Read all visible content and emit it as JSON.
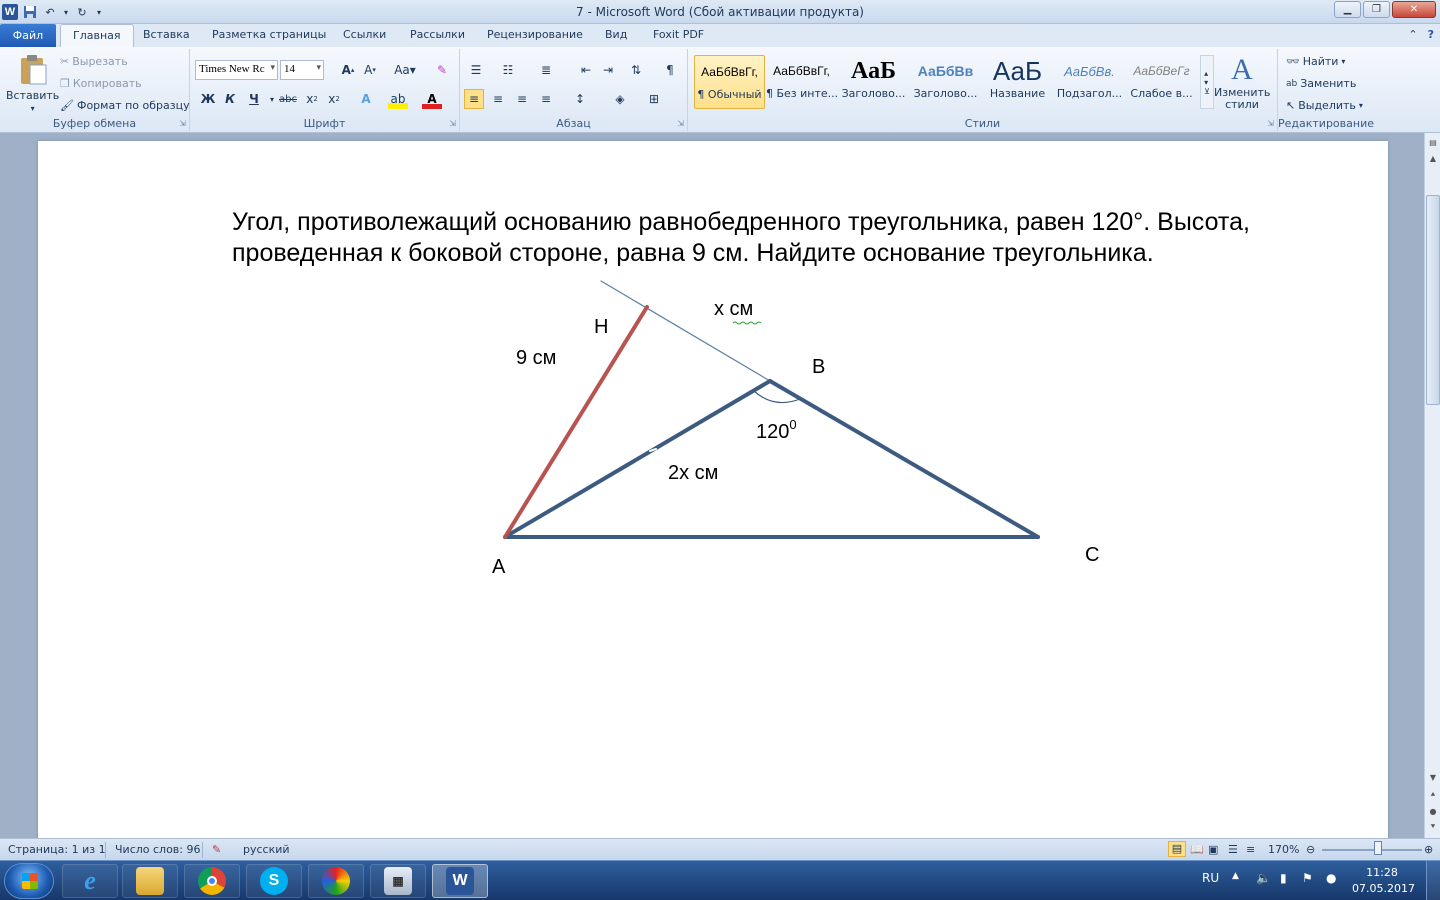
{
  "window": {
    "title": "7  -  Microsoft Word (Сбой активации продукта)",
    "app_icon": "word-icon"
  },
  "tabs": {
    "file": "Файл",
    "home": "Главная",
    "insert": "Вставка",
    "page_layout": "Разметка страницы",
    "references": "Ссылки",
    "mailings": "Рассылки",
    "review": "Рецензирование",
    "view": "Вид",
    "foxit": "Foxit PDF"
  },
  "ribbon": {
    "clipboard": {
      "label": "Буфер обмена",
      "paste": "Вставить",
      "cut": "Вырезать",
      "copy": "Копировать",
      "format_painter": "Формат по образцу"
    },
    "font": {
      "label": "Шрифт",
      "font_name": "Times New Rc",
      "font_size": "14",
      "bold": "Ж",
      "italic": "К",
      "underline": "Ч",
      "strike": "abc",
      "change_case": "Aa"
    },
    "paragraph": {
      "label": "Абзац"
    },
    "styles": {
      "label": "Стили",
      "items": [
        {
          "sample": "АаБбВвГг,",
          "name": "¶ Обычный"
        },
        {
          "sample": "АаБбВвГг,",
          "name": "¶ Без инте..."
        },
        {
          "sample": "АаБ",
          "name": "Заголово..."
        },
        {
          "sample": "АаБбВв",
          "name": "Заголово..."
        },
        {
          "sample": "АаБ",
          "name": "Название"
        },
        {
          "sample": "АаБбВв.",
          "name": "Подзагол..."
        },
        {
          "sample": "АаБбВеГг",
          "name": "Слабое в..."
        }
      ],
      "change_styles": "Изменить стили"
    },
    "editing": {
      "label": "Редактирование",
      "find": "Найти",
      "replace": "Заменить",
      "select": "Выделить"
    }
  },
  "document": {
    "problem_text": "Угол, противолежащий основанию равнобедренного треугольника, равен 120°. Высота, проведенная к боковой стороне, равна 9 см. Найдите основание треугольника.",
    "figure": {
      "label_H": "H",
      "label_B": "B",
      "label_A": "A",
      "label_C": "C",
      "label_x": "х см",
      "label_9": "9 см",
      "label_2x": "2х см",
      "label_angle": "120",
      "label_angle_sup": "0",
      "colors": {
        "triangle": "#3d5a80",
        "height": "#b85450",
        "extension": "#5b7fa6"
      }
    }
  },
  "statusbar": {
    "page": "Страница: 1 из 1",
    "words": "Число слов: 96",
    "language": "русский",
    "zoom": "170%"
  },
  "taskbar": {
    "language": "RU",
    "time": "11:28",
    "date": "07.05.2017"
  }
}
